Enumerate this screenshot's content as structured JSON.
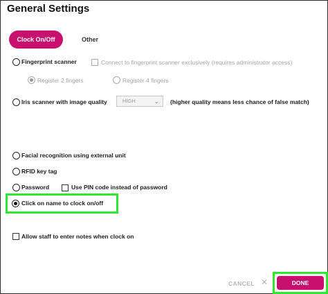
{
  "dialog": {
    "title": "General Settings"
  },
  "tabs": [
    {
      "label": "Clock On/Off",
      "active": true
    },
    {
      "label": "Other",
      "active": false
    }
  ],
  "options": {
    "fingerprint": {
      "label": "Fingerprint scanner",
      "selected": false,
      "connect_exclusive_label": "Connect to fingerprint scanner exclusively (requires administrator access)",
      "register2_label": "Register 2 fingers",
      "register2_selected": true,
      "register4_label": "Register 4 fingers",
      "register4_selected": false
    },
    "iris": {
      "label": "Iris scanner with image quality",
      "selected": false,
      "quality_value": "HIGH",
      "note": "(higher quality means less chance of false match)"
    },
    "facial": {
      "label": "Facial recognition using external unit",
      "selected": false
    },
    "rfid": {
      "label": "RFID key tag",
      "selected": false
    },
    "password": {
      "label": "Password",
      "selected": false,
      "use_pin_label": "Use PIN code instead of password",
      "use_pin_checked": false
    },
    "click_name": {
      "label": "Click on name to clock on/off",
      "selected": true
    },
    "allow_notes": {
      "label": "Allow staff to enter notes when clock on",
      "checked": false
    }
  },
  "footer": {
    "cancel_label": "CANCEL",
    "close_glyph": "✕",
    "done_label": "DONE"
  },
  "colors": {
    "accent": "#c8106f",
    "highlight": "#2ee82e"
  }
}
